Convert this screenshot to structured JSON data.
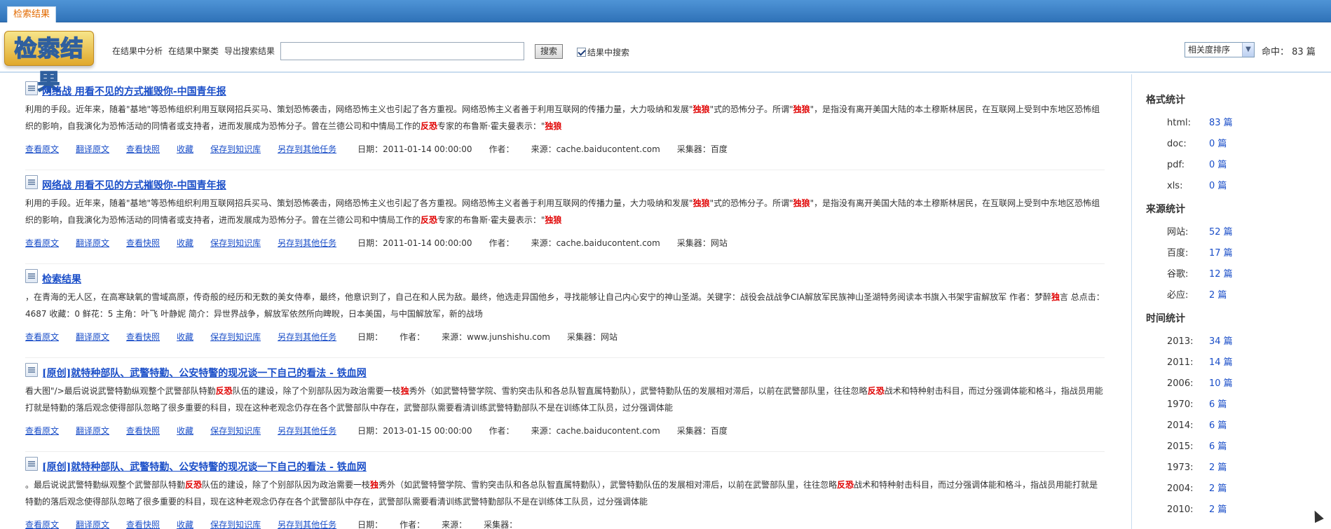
{
  "tab": {
    "label": "检索结果"
  },
  "toolbar": {
    "logo_text": "检索结果",
    "links": [
      "在结果中分析",
      "在结果中聚类",
      "导出搜索结果"
    ],
    "search_value": "",
    "search_button": "搜索",
    "within_results_label": "结果中搜索",
    "within_results_checked": true,
    "sort_selected": "相关度排序",
    "hits_label": "命中：",
    "hits_value": "83",
    "hits_unit": "篇"
  },
  "actions": [
    "查看原文",
    "翻译原文",
    "查看快照",
    "收藏",
    "保存到知识库",
    "另存到其他任务"
  ],
  "meta_labels": {
    "date": "日期：",
    "author": "作者：",
    "source": "来源：",
    "collector": "采集器："
  },
  "results": [
    {
      "title": "网络战 用看不见的方式摧毁你-中国青年报",
      "body": "利用的手段。近年来，随着\"基地\"等恐怖组织利用互联网招兵买马、策划恐怖袭击，网络恐怖主义也引起了各方重视。网络恐怖主义者善于利用互联网的传播力量，大力吸纳和发展\"[[独狼]]\"式的恐怖分子。所谓\"[[独狼]]\"，是指没有离开美国大陆的本土穆斯林居民，在互联网上受到中东地区恐怖组织的影响，自我演化为恐怖活动的同情者或支持者，进而发展成为恐怖分子。曾在兰德公司和中情局工作的[[反恐]]专家的布鲁斯·霍夫曼表示：\"[[独狼]]",
      "date": "2011-01-14 00:00:00",
      "author": "",
      "source": "cache.baiducontent.com",
      "collector": "百度"
    },
    {
      "title": "网络战 用看不见的方式摧毁你-中国青年报",
      "body": "利用的手段。近年来，随着\"基地\"等恐怖组织利用互联网招兵买马、策划恐怖袭击，网络恐怖主义也引起了各方重视。网络恐怖主义者善于利用互联网的传播力量，大力吸纳和发展\"[[独狼]]\"式的恐怖分子。所谓\"[[独狼]]\"，是指没有离开美国大陆的本土穆斯林居民，在互联网上受到中东地区恐怖组织的影响，自我演化为恐怖活动的同情者或支持者，进而发展成为恐怖分子。曾在兰德公司和中情局工作的[[反恐]]专家的布鲁斯·霍夫曼表示：\"[[独狼]]",
      "date": "2011-01-14 00:00:00",
      "author": "",
      "source": "cache.baiducontent.com",
      "collector": "网站"
    },
    {
      "title": "检索结果",
      "body": "，在青海的无人区，在高寒缺氧的雪域高原，传奇般的经历和无数的美女侍奉，最终，他意识到了，自己在和人民为敌。最终，他选走异国他乡，寻找能够让自己内心安宁的神山圣湖。关键字：战役会战战争CIA解放军民族神山圣湖特务阅读本书旗入书架宇宙解放军 作者：梦醉[[独]]言 总点击：4687 收藏：0 鲜花：5 主角：叶飞 叶静妮 简介：异世界战争，解放军依然所向睥睨，日本美国，与中国解放军，新的战场",
      "date": "",
      "author": "",
      "source": "www.junshishu.com",
      "collector": "网站"
    },
    {
      "title": "[原创]就特种部队、武警特勤、公安特警的现况谈一下自己的看法 - 铁血网",
      "body": "看大图\"/>最后说说武警特勤纵观整个武警部队特勤[[反恐]]队伍的建设，除了个别部队因为政治需要一枝[[独]]秀外（如武警特警学院、雪豹突击队和各总队智直属特勤队），武警特勤队伍的发展相对滞后，以前在武警部队里，往往忽略[[反恐]]战术和特种射击科目，而过分强调体能和格斗，指战员用能打就是特勤的落后观念使得部队忽略了很多重要的科目，现在这种老观念仍存在各个武警部队中存在，武警部队需要看清训练武警特勤部队不是在训练体工队员，过分强调体能",
      "date": "2013-01-15 00:00:00",
      "author": "",
      "source": "cache.baiducontent.com",
      "collector": "百度"
    },
    {
      "title": "[原创]就特种部队、武警特勤、公安特警的现况谈一下自己的看法 - 铁血网",
      "body": "。最后说说武警特勤纵观整个武警部队特勤[[反恐]]队伍的建设，除了个别部队因为政治需要一枝[[独]]秀外（如武警特警学院、雪豹突击队和各总队智直属特勤队），武警特勤队伍的发展相对滞后，以前在武警部队里，往往忽略[[反恐]]战术和特种射击科目，而过分强调体能和格斗，指战员用能打就是特勤的落后观念使得部队忽略了很多重要的科目，现在这种老观念仍存在各个武警部队中存在，武警部队需要看清训练武警特勤部队不是在训练体工队员，过分强调体能",
      "date": "",
      "author": "",
      "source": "",
      "collector": ""
    }
  ],
  "sidebar": {
    "sections": [
      {
        "title": "格式统计",
        "unit": "篇",
        "items": [
          {
            "key": "html:",
            "value": "83"
          },
          {
            "key": "doc:",
            "value": "0"
          },
          {
            "key": "pdf:",
            "value": "0"
          },
          {
            "key": "xls:",
            "value": "0"
          }
        ]
      },
      {
        "title": "来源统计",
        "unit": "篇",
        "items": [
          {
            "key": "网站:",
            "value": "52"
          },
          {
            "key": "百度:",
            "value": "17"
          },
          {
            "key": "谷歌:",
            "value": "12"
          },
          {
            "key": "必应:",
            "value": "2"
          }
        ]
      },
      {
        "title": "时间统计",
        "unit": "篇",
        "items": [
          {
            "key": "2013:",
            "value": "34"
          },
          {
            "key": "2011:",
            "value": "14"
          },
          {
            "key": "2006:",
            "value": "10"
          },
          {
            "key": "1970:",
            "value": "6"
          },
          {
            "key": "2014:",
            "value": "6"
          },
          {
            "key": "2015:",
            "value": "6"
          },
          {
            "key": "1973:",
            "value": "2"
          },
          {
            "key": "2004:",
            "value": "2"
          },
          {
            "key": "2010:",
            "value": "2"
          }
        ]
      }
    ]
  }
}
